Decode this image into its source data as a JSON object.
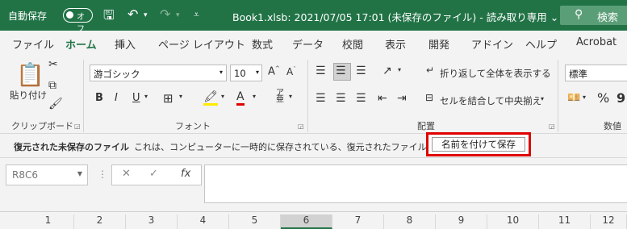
{
  "titlebar": {
    "autosave_label": "自動保存",
    "autosave_state": "オフ",
    "document_title": "Book1.xlsb: 2021/07/05 17:01 (未保存のファイル) - 読み取り専用 ⌄",
    "search_label": "検索"
  },
  "tabs": [
    "ファイル",
    "ホーム",
    "挿入",
    "ページ レイアウト",
    "数式",
    "データ",
    "校閲",
    "表示",
    "開発",
    "アドイン",
    "ヘルプ",
    "Acrobat"
  ],
  "ribbon": {
    "paste_label": "貼り付け",
    "clipboard_group": "クリップボード",
    "font_name": "游ゴシック",
    "font_size": "10",
    "font_group": "フォント",
    "wrap_text": "折り返して全体を表示する",
    "merge_center": "セルを結合して中央揃え",
    "alignment_group": "配置",
    "number_format": "標準",
    "number_group": "数値",
    "bold": "B",
    "italic": "I",
    "underline": "U"
  },
  "infobar": {
    "title": "復元された未保存のファイル",
    "message": "これは、コンピューターに一時的に保存されている、復元されたファイルです。",
    "save_as_button": "名前を付けて保存"
  },
  "formula_bar": {
    "name_box": "R8C6",
    "fx": "fx"
  },
  "columns": [
    "1",
    "2",
    "3",
    "4",
    "5",
    "6",
    "7",
    "8",
    "9",
    "10",
    "11",
    "12"
  ],
  "selected_column": "6",
  "colors": {
    "accent": "#217346",
    "highlight_box": "#e00000"
  }
}
